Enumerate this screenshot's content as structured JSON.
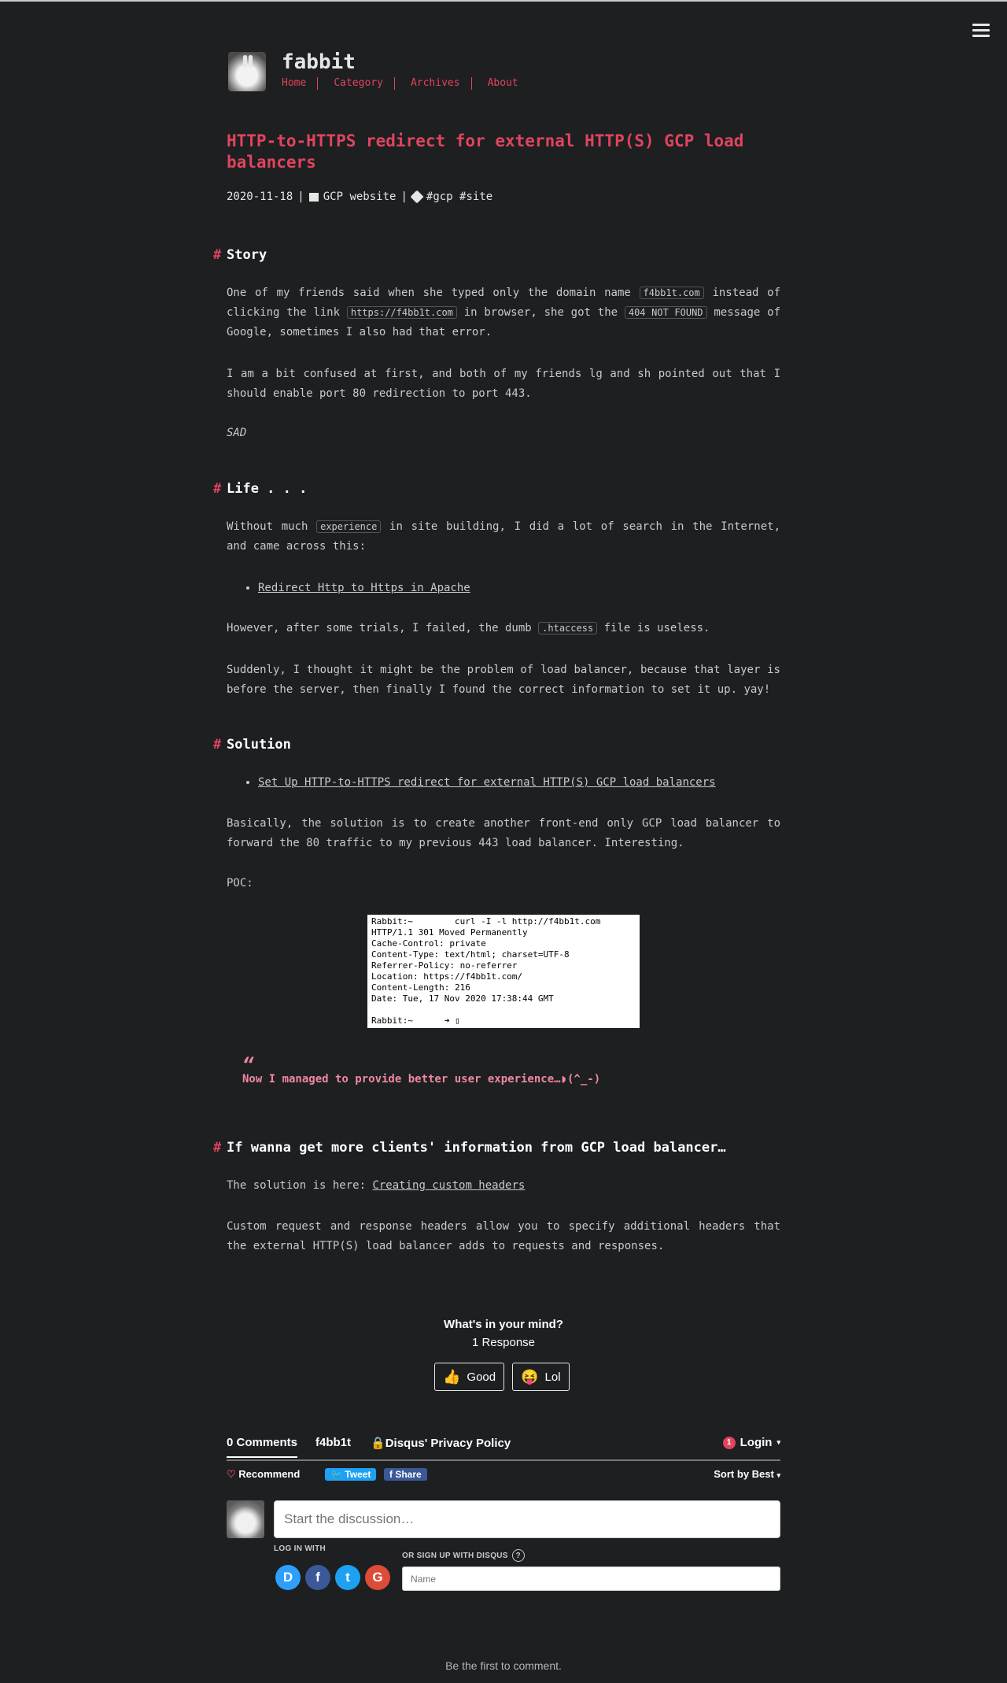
{
  "site": {
    "title": "fabbit",
    "nav": [
      "Home",
      "Category",
      "Archives",
      "About"
    ]
  },
  "post": {
    "title": "HTTP-to-HTTPS redirect for external HTTP(S) GCP load balancers",
    "date": "2020-11-18",
    "category": "GCP website",
    "tags": "#gcp #site"
  },
  "sections": {
    "story": {
      "heading": "Story",
      "p1_a": "One of my friends said when she typed only the domain name ",
      "p1_code1": "f4bb1t.com",
      "p1_b": " instead of clicking the link ",
      "p1_code2": "https://f4bb1t.com",
      "p1_c": " in browser, she got the ",
      "p1_code3": "404 NOT FOUND",
      "p1_d": " message of Google, sometimes I also had that error.",
      "p2": "I am a bit confused at first, and both of my friends lg and sh pointed out that I should enable port 80 redirection to port 443.",
      "p3": "SAD"
    },
    "life": {
      "heading": "Life . . .",
      "p1_a": "Without much ",
      "p1_code": "experience",
      "p1_b": " in site building, I did a lot of search in the Internet, and came across this:",
      "link": "Redirect Http to Https in Apache",
      "p2_a": "However, after some trials, I failed, the dumb ",
      "p2_code": ".htaccess",
      "p2_b": " file is useless.",
      "p3": "Suddenly, I thought it might be the problem of load balancer, because that layer is before the server, then finally I found the correct information to set it up. yay!"
    },
    "solution": {
      "heading": "Solution",
      "link": "Set Up HTTP-to-HTTPS redirect for external HTTP(S) GCP load balancers",
      "p1": "Basically, the solution is to create another front-end only GCP load balancer to forward the 80 traffic to my previous 443 load balancer. Interesting.",
      "p2": "POC:",
      "terminal": "Rabbit:~        curl -I -l http://f4bb1t.com\nHTTP/1.1 301 Moved Permanently\nCache-Control: private\nContent-Type: text/html; charset=UTF-8\nReferrer-Policy: no-referrer\nLocation: https://f4bb1t.com/\nContent-Length: 216\nDate: Tue, 17 Nov 2020 17:38:44 GMT\n\nRabbit:~      ➜ ▯",
      "quote": "Now I managed to provide better user experience…◗(^_-)"
    },
    "more": {
      "heading": "If wanna get more clients' information from GCP load balancer…",
      "p1_a": "The solution is here: ",
      "p1_link": "Creating custom headers",
      "p2": "Custom request and response headers allow you to specify additional headers that the external HTTP(S) load balancer adds to requests and responses."
    }
  },
  "disqus": {
    "reaction_title": "What's in your mind?",
    "response_count": "1 Response",
    "reactions": [
      {
        "emoji": "👍",
        "label": "Good"
      },
      {
        "emoji": "😝",
        "label": "Lol"
      }
    ],
    "tab_comments": "0 Comments",
    "tab_site": "f4bb1t",
    "tab_privacy": "Disqus' Privacy Policy",
    "login_badge": "1",
    "login": "Login",
    "recommend": "Recommend",
    "tweet": "Tweet",
    "share": "Share",
    "sort": "Sort by Best",
    "input_placeholder": "Start the discussion…",
    "log_in_with": "LOG IN WITH",
    "signup_with": "OR SIGN UP WITH DISQUS",
    "name_placeholder": "Name",
    "social": [
      {
        "letter": "D",
        "color": "#2e9fff"
      },
      {
        "letter": "f",
        "color": "#3b5998"
      },
      {
        "letter": "t",
        "color": "#1da1f2"
      },
      {
        "letter": "G",
        "color": "#dd4b39"
      }
    ],
    "empty": "Be the first to comment."
  }
}
